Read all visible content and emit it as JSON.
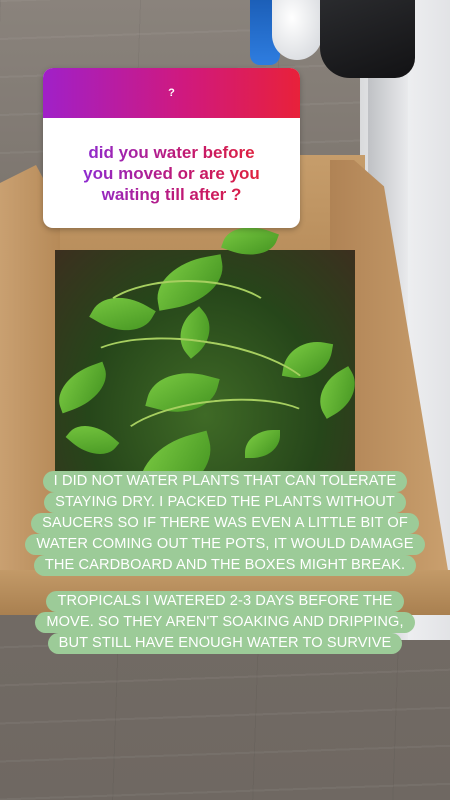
{
  "sticker": {
    "header_icon": "?",
    "question_lines": [
      "did you water before",
      "you moved or are you",
      "waiting till after ?"
    ],
    "gradient_colors": [
      "#a020c8",
      "#d0197e",
      "#e8213a"
    ]
  },
  "answer_1": {
    "lines": [
      "I DID NOT WATER PLANTS THAT CAN TOLERATE",
      "STAYING DRY. I PACKED THE PLANTS WITHOUT",
      "SAUCERS SO IF THERE WAS EVEN A LITTLE BIT OF",
      "WATER COMING OUT THE POTS, IT WOULD DAMAGE",
      "THE CARDBOARD AND THE BOXES MIGHT BREAK."
    ]
  },
  "answer_2": {
    "lines": [
      "TROPICALS I WATERED 2-3 DAYS BEFORE THE",
      "MOVE. SO THEY AREN'T SOAKING AND DRIPPING,",
      "BUT STILL HAVE ENOUGH WATER TO SURVIVE"
    ]
  },
  "colors": {
    "caption_bg": "#9ccb98",
    "caption_text": "#ffffff"
  }
}
